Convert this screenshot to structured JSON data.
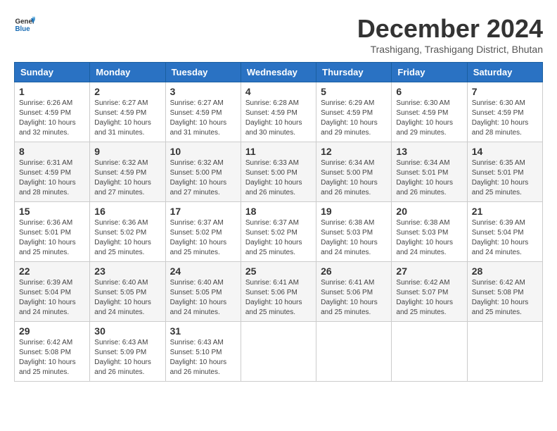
{
  "logo": {
    "line1": "General",
    "line2": "Blue"
  },
  "title": "December 2024",
  "subtitle": "Trashigang, Trashigang District, Bhutan",
  "days_of_week": [
    "Sunday",
    "Monday",
    "Tuesday",
    "Wednesday",
    "Thursday",
    "Friday",
    "Saturday"
  ],
  "weeks": [
    [
      {
        "day": "1",
        "info": "Sunrise: 6:26 AM\nSunset: 4:59 PM\nDaylight: 10 hours and 32 minutes."
      },
      {
        "day": "2",
        "info": "Sunrise: 6:27 AM\nSunset: 4:59 PM\nDaylight: 10 hours and 31 minutes."
      },
      {
        "day": "3",
        "info": "Sunrise: 6:27 AM\nSunset: 4:59 PM\nDaylight: 10 hours and 31 minutes."
      },
      {
        "day": "4",
        "info": "Sunrise: 6:28 AM\nSunset: 4:59 PM\nDaylight: 10 hours and 30 minutes."
      },
      {
        "day": "5",
        "info": "Sunrise: 6:29 AM\nSunset: 4:59 PM\nDaylight: 10 hours and 29 minutes."
      },
      {
        "day": "6",
        "info": "Sunrise: 6:30 AM\nSunset: 4:59 PM\nDaylight: 10 hours and 29 minutes."
      },
      {
        "day": "7",
        "info": "Sunrise: 6:30 AM\nSunset: 4:59 PM\nDaylight: 10 hours and 28 minutes."
      }
    ],
    [
      {
        "day": "8",
        "info": "Sunrise: 6:31 AM\nSunset: 4:59 PM\nDaylight: 10 hours and 28 minutes."
      },
      {
        "day": "9",
        "info": "Sunrise: 6:32 AM\nSunset: 4:59 PM\nDaylight: 10 hours and 27 minutes."
      },
      {
        "day": "10",
        "info": "Sunrise: 6:32 AM\nSunset: 5:00 PM\nDaylight: 10 hours and 27 minutes."
      },
      {
        "day": "11",
        "info": "Sunrise: 6:33 AM\nSunset: 5:00 PM\nDaylight: 10 hours and 26 minutes."
      },
      {
        "day": "12",
        "info": "Sunrise: 6:34 AM\nSunset: 5:00 PM\nDaylight: 10 hours and 26 minutes."
      },
      {
        "day": "13",
        "info": "Sunrise: 6:34 AM\nSunset: 5:01 PM\nDaylight: 10 hours and 26 minutes."
      },
      {
        "day": "14",
        "info": "Sunrise: 6:35 AM\nSunset: 5:01 PM\nDaylight: 10 hours and 25 minutes."
      }
    ],
    [
      {
        "day": "15",
        "info": "Sunrise: 6:36 AM\nSunset: 5:01 PM\nDaylight: 10 hours and 25 minutes."
      },
      {
        "day": "16",
        "info": "Sunrise: 6:36 AM\nSunset: 5:02 PM\nDaylight: 10 hours and 25 minutes."
      },
      {
        "day": "17",
        "info": "Sunrise: 6:37 AM\nSunset: 5:02 PM\nDaylight: 10 hours and 25 minutes."
      },
      {
        "day": "18",
        "info": "Sunrise: 6:37 AM\nSunset: 5:02 PM\nDaylight: 10 hours and 25 minutes."
      },
      {
        "day": "19",
        "info": "Sunrise: 6:38 AM\nSunset: 5:03 PM\nDaylight: 10 hours and 24 minutes."
      },
      {
        "day": "20",
        "info": "Sunrise: 6:38 AM\nSunset: 5:03 PM\nDaylight: 10 hours and 24 minutes."
      },
      {
        "day": "21",
        "info": "Sunrise: 6:39 AM\nSunset: 5:04 PM\nDaylight: 10 hours and 24 minutes."
      }
    ],
    [
      {
        "day": "22",
        "info": "Sunrise: 6:39 AM\nSunset: 5:04 PM\nDaylight: 10 hours and 24 minutes."
      },
      {
        "day": "23",
        "info": "Sunrise: 6:40 AM\nSunset: 5:05 PM\nDaylight: 10 hours and 24 minutes."
      },
      {
        "day": "24",
        "info": "Sunrise: 6:40 AM\nSunset: 5:05 PM\nDaylight: 10 hours and 24 minutes."
      },
      {
        "day": "25",
        "info": "Sunrise: 6:41 AM\nSunset: 5:06 PM\nDaylight: 10 hours and 25 minutes."
      },
      {
        "day": "26",
        "info": "Sunrise: 6:41 AM\nSunset: 5:06 PM\nDaylight: 10 hours and 25 minutes."
      },
      {
        "day": "27",
        "info": "Sunrise: 6:42 AM\nSunset: 5:07 PM\nDaylight: 10 hours and 25 minutes."
      },
      {
        "day": "28",
        "info": "Sunrise: 6:42 AM\nSunset: 5:08 PM\nDaylight: 10 hours and 25 minutes."
      }
    ],
    [
      {
        "day": "29",
        "info": "Sunrise: 6:42 AM\nSunset: 5:08 PM\nDaylight: 10 hours and 25 minutes."
      },
      {
        "day": "30",
        "info": "Sunrise: 6:43 AM\nSunset: 5:09 PM\nDaylight: 10 hours and 26 minutes."
      },
      {
        "day": "31",
        "info": "Sunrise: 6:43 AM\nSunset: 5:10 PM\nDaylight: 10 hours and 26 minutes."
      },
      {
        "day": "",
        "info": ""
      },
      {
        "day": "",
        "info": ""
      },
      {
        "day": "",
        "info": ""
      },
      {
        "day": "",
        "info": ""
      }
    ]
  ]
}
